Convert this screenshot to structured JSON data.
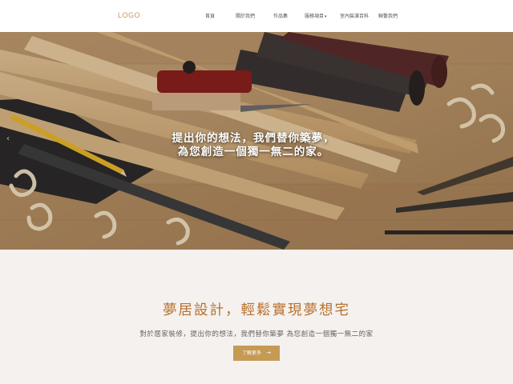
{
  "header": {
    "logo": "LOGO",
    "nav": [
      {
        "label": "首頁"
      },
      {
        "label": "關於我們"
      },
      {
        "label": "作品集"
      },
      {
        "label": "服務項目",
        "has_dropdown": true
      },
      {
        "label": "室內裝潢百科"
      },
      {
        "label": "聯繫我們"
      }
    ]
  },
  "hero": {
    "line1": "提出你的想法，我們替你築夢，",
    "line2": "為您創造一個獨一無二的家。",
    "prev_arrow": "‹"
  },
  "intro": {
    "title": "夢居設計，輕鬆實現夢想宅",
    "description": "對於居家裝修，提出你的想法，我們替你築夢 為您創造一個獨一無二的家",
    "button_label": "了解更多",
    "button_arrow": "→"
  },
  "colors": {
    "accent": "#c49a55",
    "title": "#b8702c",
    "background": "#f4f1ee"
  },
  "icons": {
    "prev": "chevron-left-icon",
    "dropdown": "caret-down-icon",
    "button": "arrow-right-icon"
  }
}
